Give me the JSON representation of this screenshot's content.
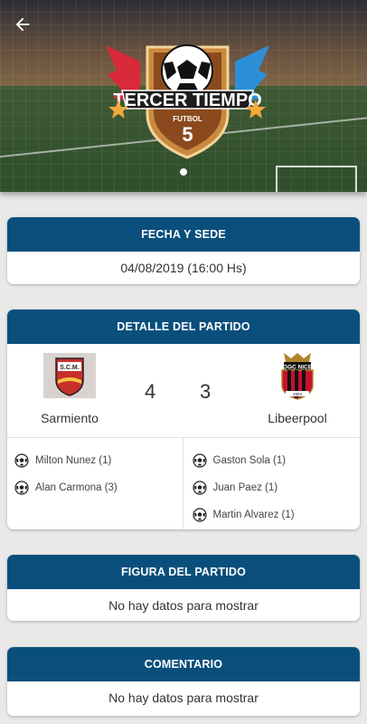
{
  "header": {
    "back_icon": "arrow-left-icon",
    "logo": {
      "line1": "TERCER TIEMPO",
      "line2": "FUTBOL",
      "line3": "5"
    },
    "carousel_dots": 1
  },
  "fecha_sede": {
    "title": "FECHA Y SEDE",
    "value": "04/08/2019 (16:00 Hs)"
  },
  "detalle": {
    "title": "DETALLE DEL PARTIDO",
    "home": {
      "name": "Sarmiento",
      "score": "4",
      "crest_text": "S.C.M."
    },
    "away": {
      "name": "Libeerpool",
      "score": "3",
      "crest_text": "OGC NICE",
      "crest_year": "1904"
    },
    "home_scorers": [
      {
        "name": "Milton Nunez (1)",
        "icon": "soccer-ball-icon"
      },
      {
        "name": "Alan Carmona (3)",
        "icon": "soccer-ball-icon"
      }
    ],
    "away_scorers": [
      {
        "name": "Gaston Sola (1)",
        "icon": "soccer-ball-icon"
      },
      {
        "name": "Juan Paez (1)",
        "icon": "soccer-ball-icon"
      },
      {
        "name": "Martin Alvarez (1)",
        "icon": "soccer-ball-icon"
      }
    ]
  },
  "figura": {
    "title": "FIGURA DEL PARTIDO",
    "value": "No hay datos para mostrar"
  },
  "comentario": {
    "title": "COMENTARIO",
    "value": "No hay datos para mostrar"
  },
  "colors": {
    "header_blue": "#0a4f7c",
    "background": "#e9e9e9"
  }
}
